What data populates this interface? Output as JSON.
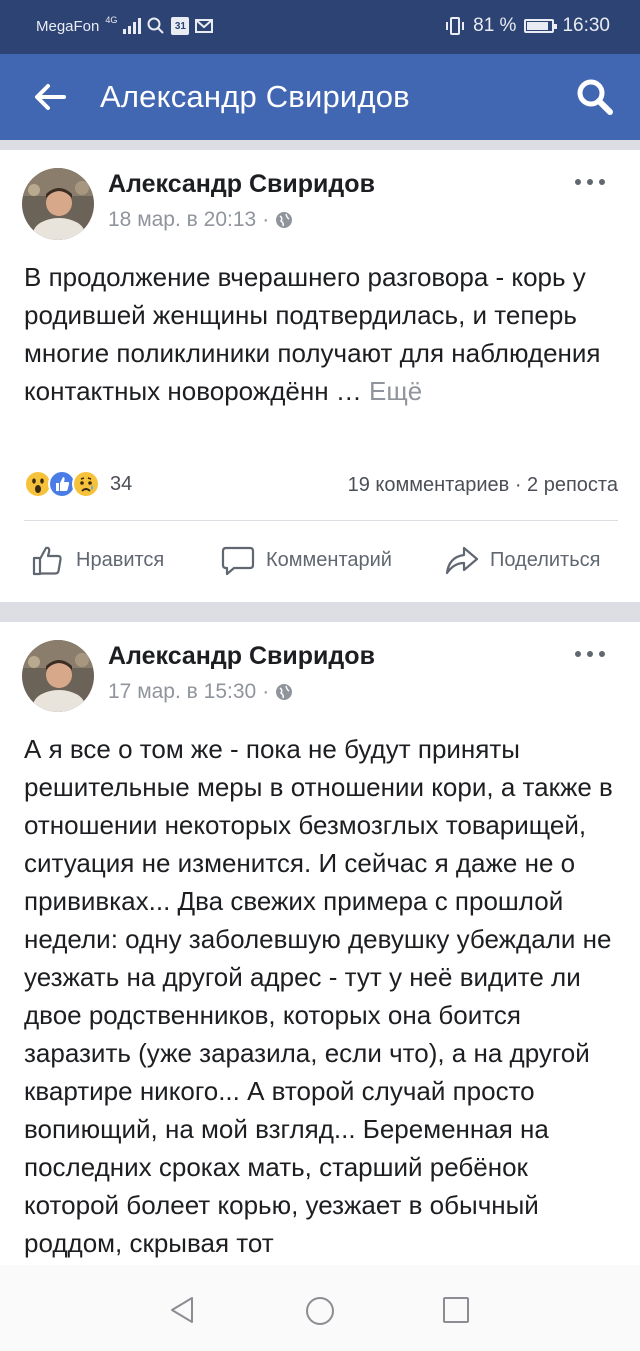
{
  "status_bar": {
    "carrier": "MegaFon",
    "network": "4G",
    "battery": "81 %",
    "time": "16:30",
    "calendar_day": "31"
  },
  "header": {
    "title": "Александр Свиридов"
  },
  "posts": [
    {
      "author": "Александр Свиридов",
      "date": "18 мар. в 20:13",
      "text": "В продолжение вчерашнего разговора - корь у родившей женщины подтвердилась, и теперь многие поликлиники получают для наблюдения контактных новорождённ …",
      "see_more": "Ещё",
      "reaction_count": "34",
      "stats": "19 комментариев · 2 репоста",
      "reactions": [
        "wow",
        "like",
        "sad"
      ]
    },
    {
      "author": "Александр Свиридов",
      "date": "17 мар. в 15:30",
      "text": "А я все о том же - пока не будут приняты решительные меры в отношении кори, а также в отношении некоторых безмозглых товарищей, ситуация не изменится. И сейчас я даже не о прививках... Два свежих примера с прошлой недели: одну заболевшую девушку убеждали не уезжать на другой адрес - тут у неё видите ли двое родственников, которых она боится заразить (уже заразила, если что), а на другой квартире никого... А второй случай просто вопиющий, на мой взгляд... Беременная на последних сроках мать, старший ребёнок которой болеет корью, уезжает в обычный роддом, скрывая тот"
    }
  ],
  "actions": {
    "like": "Нравится",
    "comment": "Комментарий",
    "share": "Поделиться"
  },
  "colors": {
    "header": "#4267b2",
    "status_bar": "#2d4373",
    "feed_background": "#dcdee3"
  }
}
